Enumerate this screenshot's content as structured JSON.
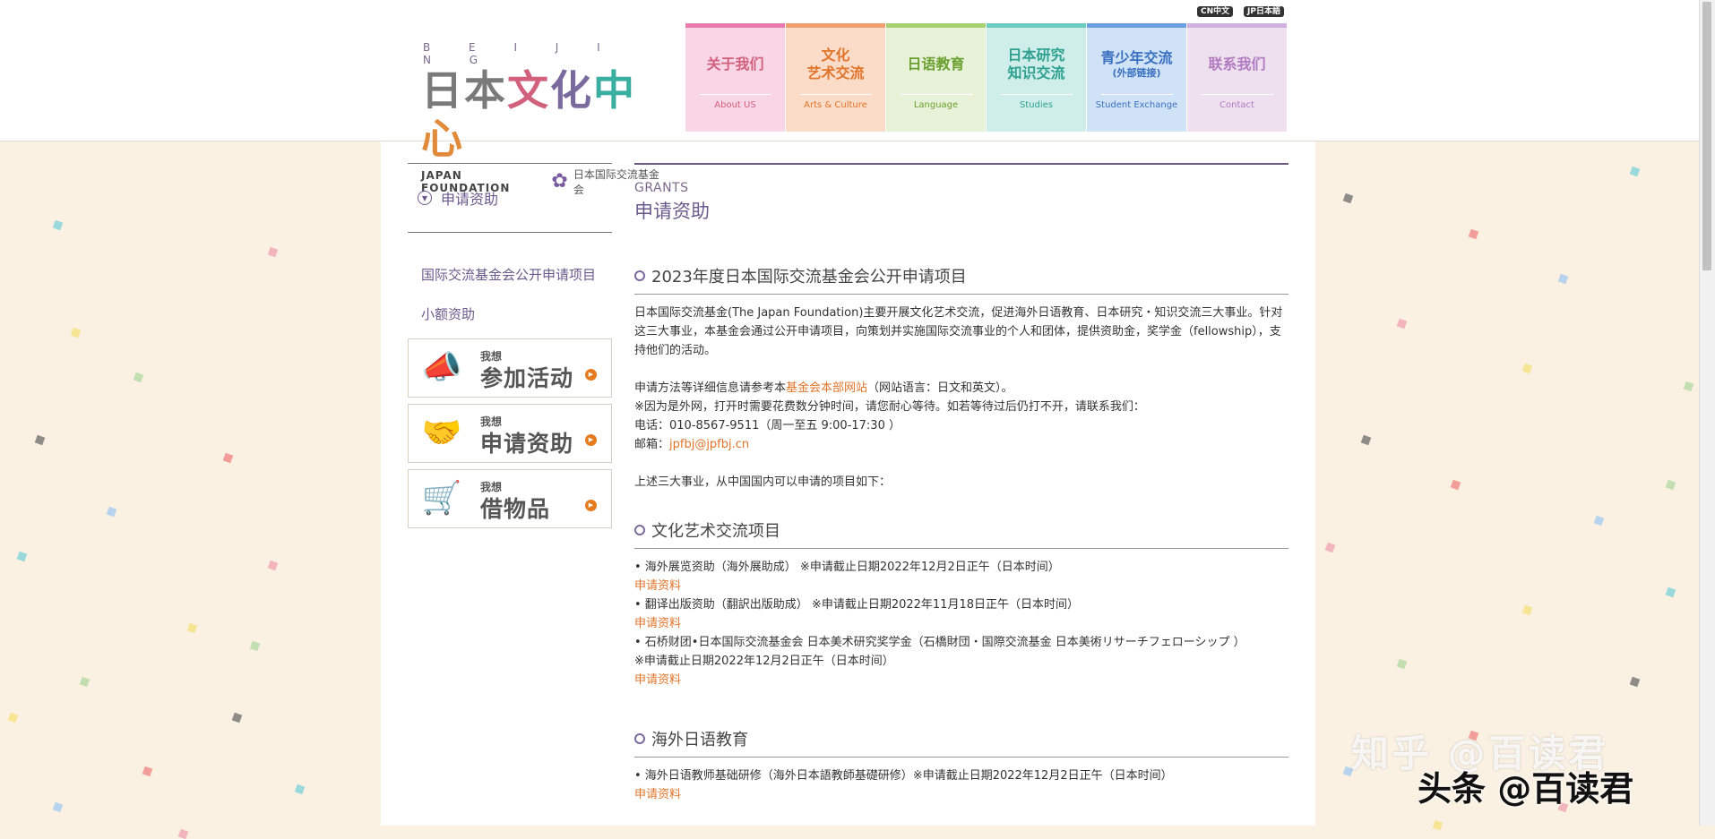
{
  "brand": {
    "top_letters": "B E I J I N G",
    "main": [
      "日",
      "本",
      "文",
      "化",
      "中",
      "心"
    ],
    "org_en": "JAPAN FOUNDATION",
    "org_zh": "日本国际交流基金会"
  },
  "lang": {
    "cn": "CN中文",
    "jp": "JP日本語"
  },
  "nav": [
    {
      "zh": "关于我们",
      "sub": "",
      "en": "About US",
      "bar": "#e87ab0",
      "bg": "#f9d6e6",
      "color": "#d1607c"
    },
    {
      "zh": "文化",
      "sub": "艺术交流",
      "en": "Arts & Culture",
      "bar": "#f0a070",
      "bg": "#fbdcc8",
      "color": "#e0742a"
    },
    {
      "zh": "日语教育",
      "sub": "",
      "en": "Language",
      "bar": "#a8d070",
      "bg": "#e8f2d8",
      "color": "#6aa030"
    },
    {
      "zh": "日本研究",
      "sub": "知识交流",
      "en": "Studies",
      "bar": "#6ccac0",
      "bg": "#cfeeea",
      "color": "#2ea090"
    },
    {
      "zh": "青少年交流",
      "sub": "(外部链接)",
      "en": "Student Exchange",
      "bar": "#6aa0e0",
      "bg": "#d0e2f6",
      "color": "#3a70c0"
    },
    {
      "zh": "联系我们",
      "sub": "",
      "en": "Contact",
      "bar": "#d0b0e0",
      "bg": "#efe0f0",
      "color": "#b07ac0"
    }
  ],
  "sidebar": {
    "header": "申请资助",
    "links": [
      "国际交流基金会公开申请项目",
      "小额资助"
    ],
    "promos": [
      {
        "small": "我想",
        "big": "参加活动",
        "icon": "megaphone-icon",
        "glyph": "📣"
      },
      {
        "small": "我想",
        "big": "申请资助",
        "icon": "handshake-icon",
        "glyph": "🤝"
      },
      {
        "small": "我想",
        "big": "借物品",
        "icon": "cart-icon",
        "glyph": "🛒"
      }
    ]
  },
  "main": {
    "title_en": "GRANTS",
    "title_zh": "申请资助",
    "section1": {
      "heading": "2023年度日本国际交流基金会公开申请项目",
      "intro": "日本国际交流基金(The Japan Foundation)主要开展文化艺术交流，促进海外日语教育、日本研究・知识交流三大事业。针对这三大事业，本基金会通过公开申请项目，向策划并实施国际交流事业的个人和团体，提供资助金，奖学金（fellowship），支持他们的活动。",
      "method_pre": "申请方法等详细信息请参考本",
      "method_link": "基金会本部网站",
      "method_post": "（网站语言：日文和英文）。",
      "note": "※因为是外网，打开时需要花费数分钟时间，请您耐心等待。如若等待过后仍打不开，请联系我们：",
      "phone": "电话：010-8567-9511（周一至五 9:00-17:30 ）",
      "email_label": "邮箱：",
      "email": "jpfbj@jpfbj.cn",
      "list_intro": "上述三大事业，从中国国内可以申请的项目如下："
    },
    "section2": {
      "heading": "文化艺术交流项目",
      "items": [
        {
          "text": "• 海外展览资助（海外展助成） ※申请截止日期2022年12月2日正午（日本时间）",
          "link": "申请资料"
        },
        {
          "text": "• 翻译出版资助（翻訳出版助成） ※申请截止日期2022年11月18日正午（日本时间）",
          "link": "申请资料"
        },
        {
          "text": "• 石桥财团•日本国际交流基金会 日本美术研究奖学金（石橋財団・国際交流基金 日本美術リサーチフェローシップ ）",
          "text2": "※申请截止日期2022年12月2日正午（日本时间）",
          "link": "申请资料"
        }
      ]
    },
    "section3": {
      "heading": "海外日语教育",
      "items": [
        {
          "text": "• 海外日语教师基础研修（海外日本語教師基礎研修）※申请截止日期2022年12月2日正午（日本时间）",
          "link": "申请资料"
        }
      ]
    }
  },
  "watermarks": {
    "zhihu": "知乎 @百读君",
    "toutiao": "头条 @百读君"
  }
}
